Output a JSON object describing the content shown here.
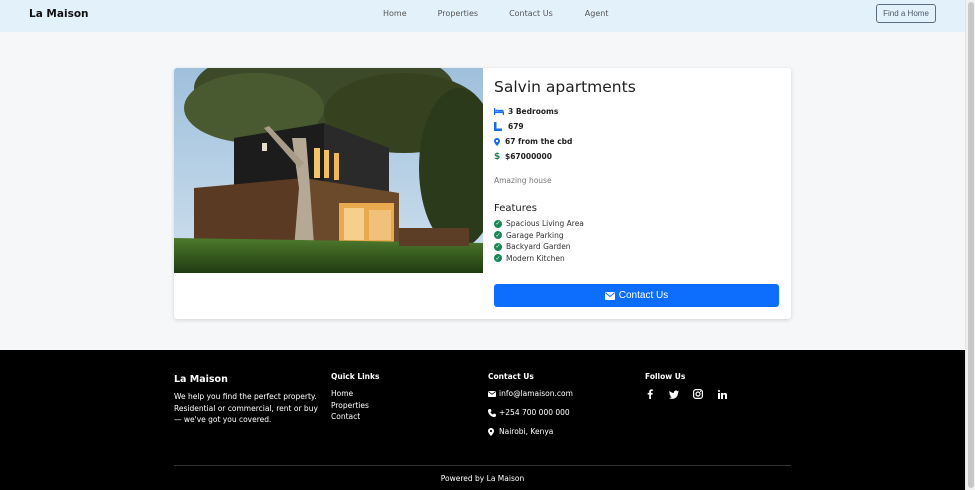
{
  "nav": {
    "brand": "La Maison",
    "links": [
      "Home",
      "Properties",
      "Contact Us",
      "Agent"
    ],
    "cta": "Find a Home"
  },
  "property": {
    "title": "Salvin apartments",
    "bedrooms": "3 Bedrooms",
    "area": "679",
    "location": "67 from the cbd",
    "price": "$67000000",
    "description": "Amazing house",
    "features_heading": "Features",
    "features": [
      "Spacious Living Area",
      "Garage Parking",
      "Backyard Garden",
      "Modern Kitchen"
    ],
    "contact_label": "Contact Us"
  },
  "footer": {
    "brand": "La Maison",
    "blurb": "We help you find the perfect property. Residential or commercial, rent or buy — we've got you covered.",
    "quick_links_heading": "Quick Links",
    "quick_links": [
      "Home",
      "Properties",
      "Contact"
    ],
    "contact_heading": "Contact Us",
    "email": "info@lamaison.com",
    "phone": "+254 700 000 000",
    "address": "Nairobi, Kenya",
    "follow_heading": "Follow Us",
    "social_icons": [
      "facebook-icon",
      "twitter-icon",
      "instagram-icon",
      "linkedin-icon"
    ],
    "powered": "Powered by La Maison"
  },
  "colors": {
    "navbar_bg": "#e3f1fb",
    "primary": "#0d6efd",
    "success": "#198754",
    "footer_bg": "#000000"
  }
}
